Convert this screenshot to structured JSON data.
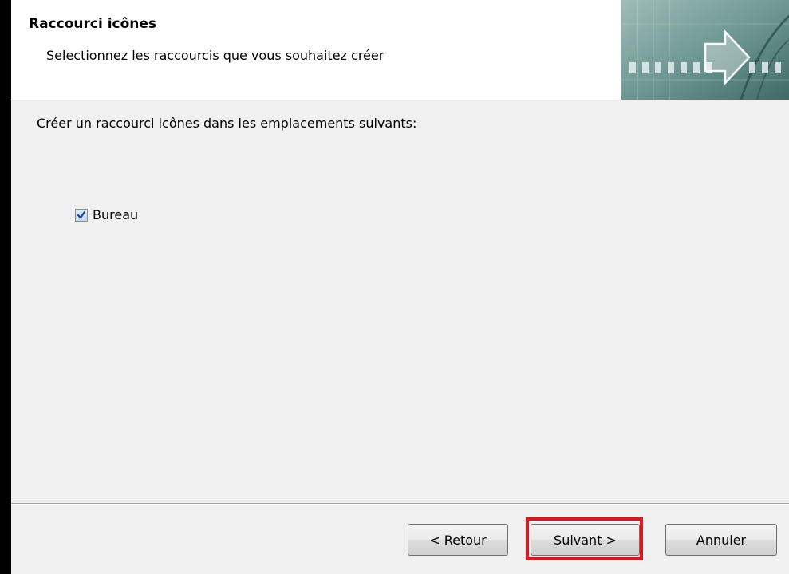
{
  "header": {
    "title": "Raccourci icônes",
    "subtitle": "Selectionnez les raccourcis que vous souhaitez créer"
  },
  "main": {
    "instruction": "Créer un raccourci icônes dans les emplacements suivants:",
    "options": [
      {
        "label": "Bureau",
        "checked": true
      }
    ]
  },
  "buttons": {
    "back_label": "< Retour",
    "next_label": "Suivant >",
    "cancel_label": "Annuler"
  },
  "annotation": {
    "highlight_color": "#e0141c",
    "highlight_target": "next-button"
  },
  "colors": {
    "header_background": "#ffffff",
    "dialog_background": "#f0f0f0",
    "banner_teal": "#5b8a86"
  }
}
